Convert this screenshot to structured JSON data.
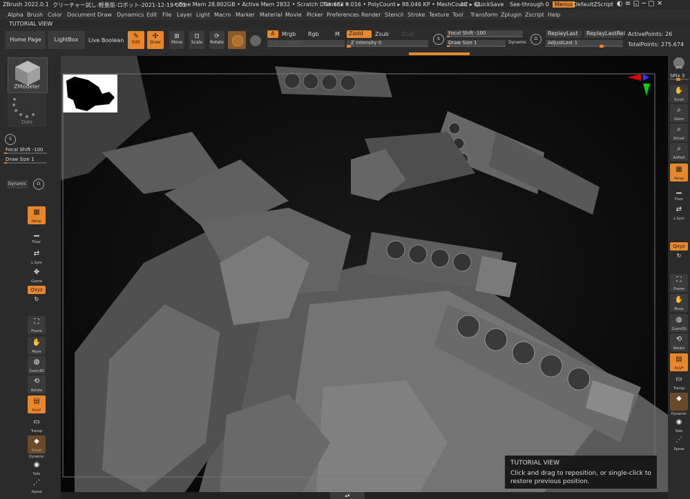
{
  "titlebar": {
    "app": "ZBrush 2022.0.1",
    "doc": "クリーチャー試し-軽量版-ロボット-2021-12-19-001",
    "freemem": "• Free Mem 28.802GB • Active Mem 2832 • Scratch Disk 682 •",
    "timer": "Timer ▸ 0.016 • PolyCount ▸ 88.046 KP • MeshCount ▸ 61",
    "ac": "AC",
    "quicksave": "QuickSave",
    "seethrough": "See-through  0",
    "menus": "Menus",
    "script": "DefaultZScript"
  },
  "menubar": [
    "Alpha",
    "Brush",
    "Color",
    "Document",
    "Draw",
    "Dynamics",
    "Edit",
    "File",
    "Layer",
    "Light",
    "Macro",
    "Marker",
    "Material",
    "Movie",
    "Picker",
    "Preferences",
    "Render",
    "Stencil",
    "Stroke",
    "Texture",
    "Tool",
    "Transform",
    "Zplugin",
    "Zscript",
    "Help"
  ],
  "tutorial_label": "TUTORIAL VIEW",
  "toolbar": {
    "home": "Home Page",
    "lightbox": "LightBox",
    "liveboolean": "Live Boolean",
    "edit": "Edit",
    "draw": "Draw",
    "move": "Move",
    "scale": "Scale",
    "rotate": "Rotate",
    "a": "A",
    "mrgb": "Mrgb",
    "rgb": "Rgb",
    "m": "M",
    "zadd": "Zadd",
    "zsub": "Zsub",
    "zcut": "Zcut",
    "rgb_intensity": "Rgb Intensity",
    "z_intensity": "Z Intensity 0",
    "focal_shift": "Focal Shift -100",
    "draw_size": "Draw Size 1",
    "dynamic": "Dynamic",
    "replaylast": "ReplayLast",
    "replaylastrel": "ReplayLastRel",
    "adjustlast": "AdjustLast 1",
    "activepoints": "ActivePoints: 26",
    "totalpoints": "TotalPoints: 275.674"
  },
  "lefttray": {
    "zmodeler": "ZModeler",
    "dots": "Dots",
    "focal_shift": "Focal Shift -100",
    "draw_size": "Draw Size 1",
    "dynamic": "Dynamic",
    "buttons": [
      "Persp",
      "Floor",
      "L.Sym",
      "Gizmo",
      "Qxyz",
      "",
      "Frame",
      "Move",
      "Zoom3D",
      "Rotate",
      "PolyF",
      "Transp",
      "Ghost",
      "Dynamic",
      "Solo",
      "Xpose"
    ]
  },
  "righttray": {
    "bpr": "BPR",
    "spix": "SPix 3",
    "buttons": [
      "Scroll",
      "Zoom",
      "Actual",
      "AAHalf",
      "Persp",
      "Floor",
      "L.Sym",
      "Qxyz",
      "",
      "Frame",
      "Move",
      "Zoom3D",
      "Rotate",
      "PolyF",
      "Transp",
      "Dynamic",
      "Solo",
      "Xpose"
    ]
  },
  "tooltip": {
    "title": "TUTORIAL VIEW",
    "body": "Click and drag to reposition, or single-click to restore previous position."
  },
  "colors": {
    "accent": "#e8862c",
    "bg": "#2b2b2b",
    "viewport": "#111111"
  }
}
